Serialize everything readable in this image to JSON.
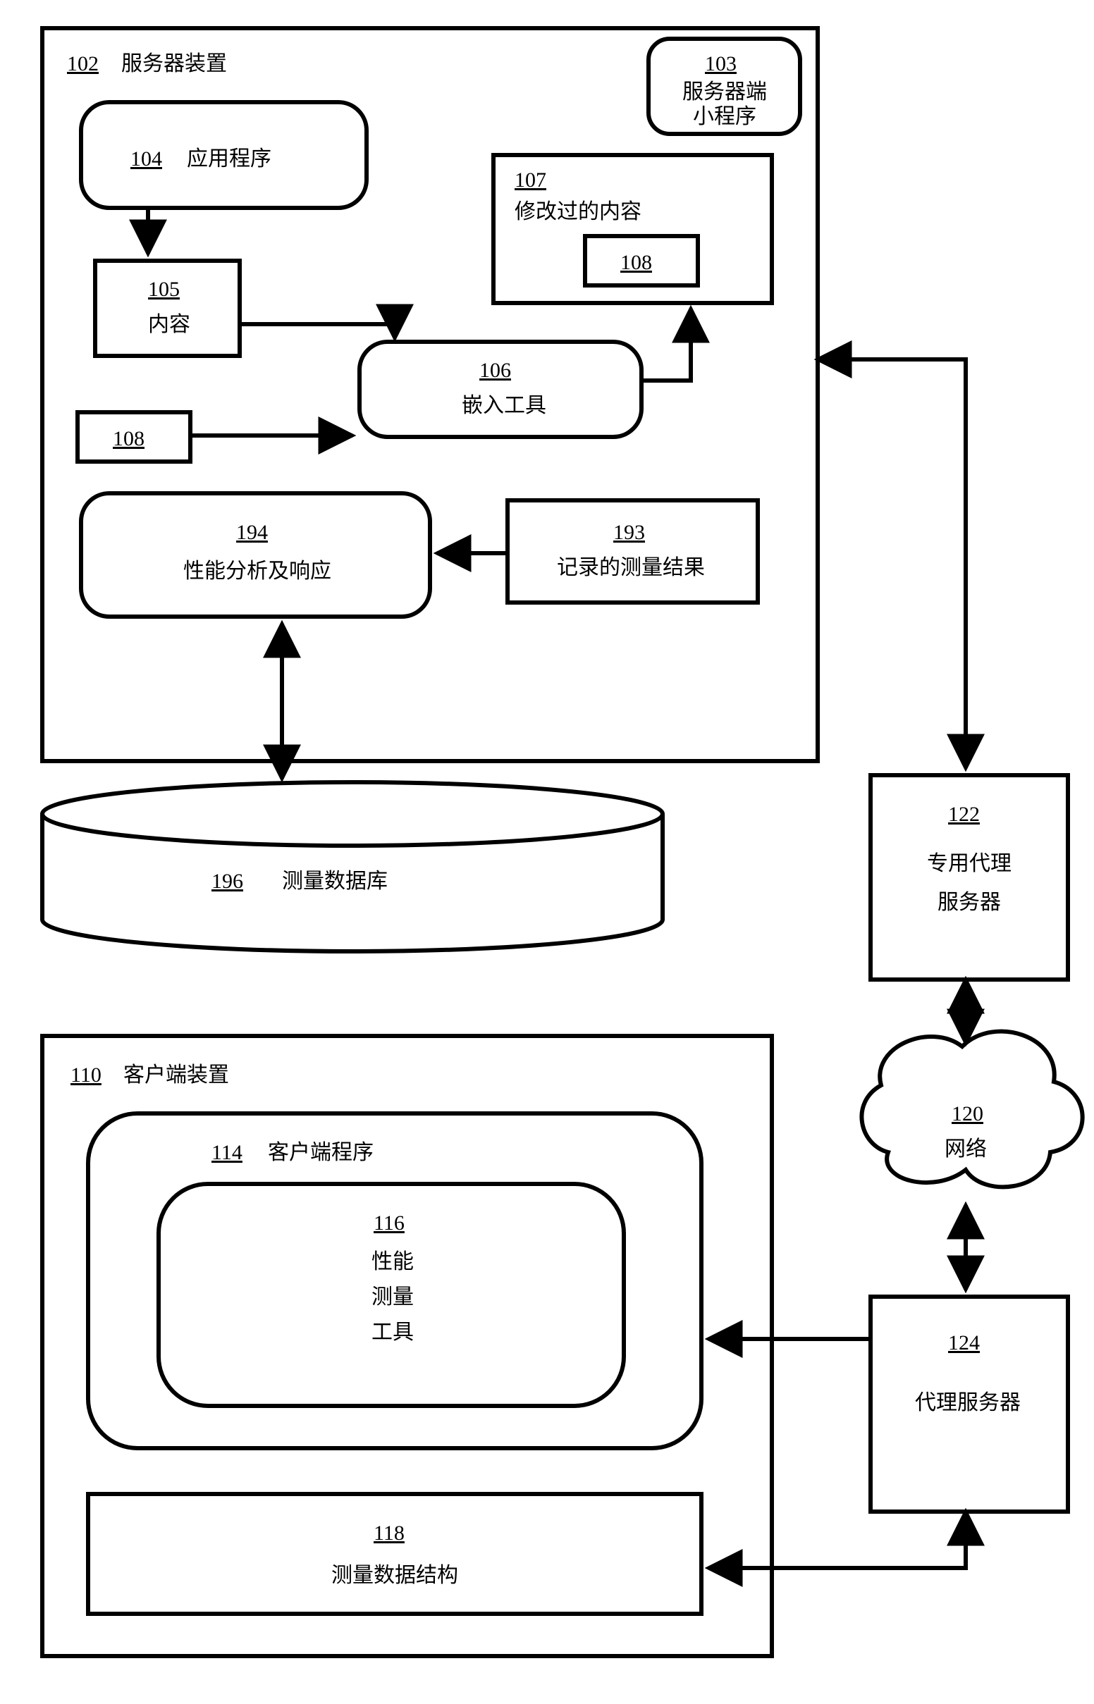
{
  "nodes": {
    "server_device": {
      "num": "102",
      "label": "服务器装置"
    },
    "servlet": {
      "num": "103",
      "label": "服务器端小程序"
    },
    "application": {
      "num": "104",
      "label": "应用程序"
    },
    "content": {
      "num": "105",
      "label": "内容"
    },
    "embed_tool": {
      "num": "106",
      "label": "嵌入工具"
    },
    "modified_content": {
      "num": "107",
      "label": "修改过的内容"
    },
    "inner108": {
      "num": "108",
      "label": ""
    },
    "outer108": {
      "num": "108",
      "label": ""
    },
    "perf_analysis": {
      "num": "194",
      "label": "性能分析及响应"
    },
    "recorded_results": {
      "num": "193",
      "label": "记录的测量结果"
    },
    "measurement_db": {
      "num": "196",
      "label": "测量数据库"
    },
    "client_device": {
      "num": "110",
      "label": "客户端装置"
    },
    "client_program": {
      "num": "114",
      "label": "客户端程序"
    },
    "perf_tool": {
      "num": "116",
      "label_l1": "性能",
      "label_l2": "测量",
      "label_l3": "工具"
    },
    "measurement_struct": {
      "num": "118",
      "label": "测量数据结构"
    },
    "network": {
      "num": "120",
      "label": "网络"
    },
    "dedicated_proxy": {
      "num": "122",
      "label": "专用代理服务器"
    },
    "proxy_server": {
      "num": "124",
      "label": "代理服务器"
    }
  }
}
